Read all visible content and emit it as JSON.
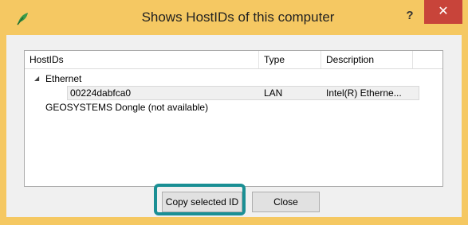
{
  "window": {
    "title": "Shows HostIDs of this computer",
    "help_label": "?",
    "close_label": "✕"
  },
  "columns": {
    "hostids": "HostIDs",
    "type": "Type",
    "description": "Description"
  },
  "tree": {
    "expander": "◢",
    "group_label": "Ethernet",
    "child": {
      "hostid": "00224dabfca0",
      "type": "LAN",
      "description": "Intel(R) Etherne..."
    },
    "dongle_label": "GEOSYSTEMS Dongle (not available)"
  },
  "buttons": {
    "copy_label": "Copy selected ID",
    "close_label": "Close"
  },
  "colors": {
    "frame": "#f5c862",
    "close_button": "#c8443a",
    "focus_highlight": "#1a8f94"
  }
}
